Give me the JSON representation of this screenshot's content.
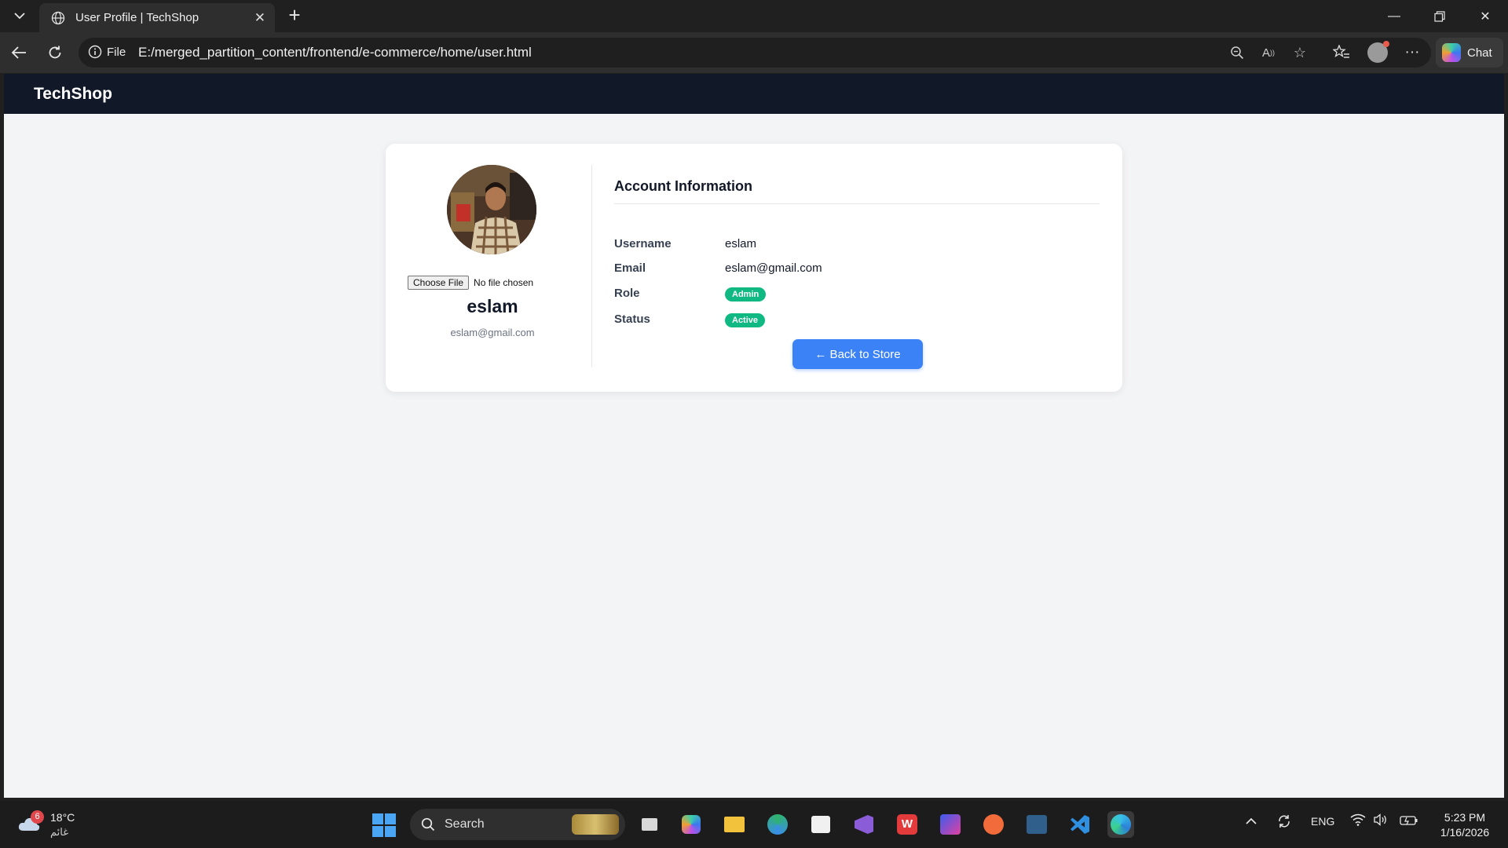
{
  "browser": {
    "tab_title": "User Profile | TechShop",
    "address_prefix": "File",
    "url": "E:/merged_partition_content/frontend/e-commerce/home/user.html",
    "chat_label": "Chat"
  },
  "page": {
    "brand": "TechShop",
    "profile": {
      "file_button": "Choose File",
      "file_status": "No file chosen",
      "name": "eslam",
      "email": "eslam@gmail.com"
    },
    "account": {
      "title": "Account Information",
      "username_label": "Username",
      "username_value": "eslam",
      "email_label": "Email",
      "email_value": "eslam@gmail.com",
      "role_label": "Role",
      "role_value": "Admin",
      "status_label": "Status",
      "status_value": "Active",
      "badge_color": "#10b981"
    },
    "back_button": "← Back to Store",
    "accent_color": "#3b82f6"
  },
  "taskbar": {
    "weather_temp": "18°C",
    "weather_cond": "غائم",
    "weather_badge": "6",
    "search_label": "Search",
    "lang": "ENG",
    "time": "5:23 PM",
    "date": "1/16/2026"
  }
}
